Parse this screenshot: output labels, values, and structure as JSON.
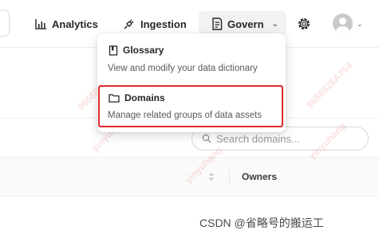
{
  "nav": {
    "analytics": "Analytics",
    "ingestion": "Ingestion",
    "govern": "Govern",
    "caret": "⌄",
    "avatar_caret": "⌄"
  },
  "dropdown": {
    "items": [
      {
        "label": "Glossary",
        "description": "View and modify your data dictionary",
        "icon": "book-icon"
      },
      {
        "label": "Domains",
        "description": "Manage related groups of data assets",
        "icon": "folder-icon"
      }
    ],
    "highlight_color": "#e0282c"
  },
  "search": {
    "placeholder": "Search domains..."
  },
  "table": {
    "owners_header": "Owners"
  },
  "watermarks": [
    "9658B28A754",
    "yinyuhang",
    "9658B28A754",
    "yinyuhang",
    "9658828A754",
    "yinyuhang"
  ],
  "footer_watermark": "CSDN @省略号的搬运工",
  "colors": {
    "govern_bg": "#f2f2f2",
    "text": "#262626",
    "muted": "#595959"
  }
}
